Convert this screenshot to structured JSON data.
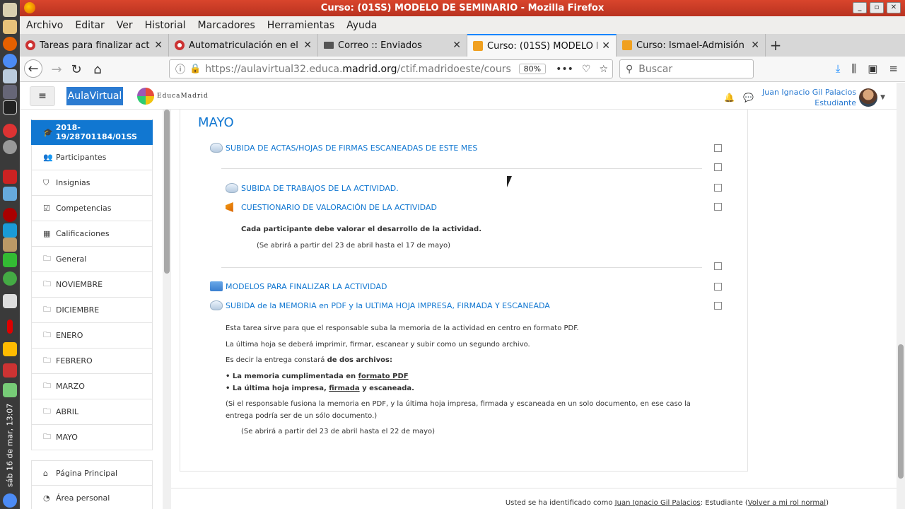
{
  "window": {
    "title": "Curso: (01SS) MODELO DE SEMINARIO - Mozilla Firefox"
  },
  "menu": [
    "Archivo",
    "Editar",
    "Ver",
    "Historial",
    "Marcadores",
    "Herramientas",
    "Ayuda"
  ],
  "tabs": [
    {
      "label": "Tareas para finalizar act",
      "active": false
    },
    {
      "label": "Automatriculación en el",
      "active": false
    },
    {
      "label": "Correo :: Enviados",
      "active": false
    },
    {
      "label": "Curso: (01SS) MODELO D",
      "active": true
    },
    {
      "label": "Curso: Ismael-Admisión",
      "active": false
    }
  ],
  "nav": {
    "url_prefix": "https://aulavirtual32.educa.",
    "url_domain": "madrid.org",
    "url_suffix": "/ctif.madridoeste/cours",
    "zoom": "80%",
    "search_placeholder": "Buscar"
  },
  "site": {
    "hamburger": "≡",
    "aula_button": "AulaVirtual",
    "logo_text": "EducaMadrid",
    "user_name": "Juan Ignacio Gil Palacios",
    "user_role": "Estudiante"
  },
  "sidebar": {
    "course": "2018-19/28701184/01SS",
    "items": [
      "Participantes",
      "Insignias",
      "Competencias",
      "Calificaciones",
      "General",
      "NOVIEMBRE",
      "DICIEMBRE",
      "ENERO",
      "FEBRERO",
      "MARZO",
      "ABRIL",
      "MAYO"
    ],
    "bottom": [
      "Página Principal",
      "Área personal"
    ]
  },
  "main": {
    "section_title": "MAYO",
    "activities": [
      "SUBIDA DE ACTAS/HOJAS DE FIRMAS ESCANEADAS DE ESTE MES",
      "SUBIDA DE TRABAJOS DE LA ACTIVIDAD.",
      "CUESTIONARIO DE VALORACIÓN DE LA ACTIVIDAD",
      "MODELOS PARA FINALIZAR LA ACTIVIDAD",
      "SUBIDA de la MEMORIA en PDF y la ULTIMA HOJA IMPRESA, FIRMADA Y ESCANEADA"
    ],
    "quest_desc": "Cada participante debe valorar el desarrollo de la actividad.",
    "quest_dates": "(Se abrirá a partir del 23 de abril hasta el 17 de mayo)",
    "memo_p1": "Esta tarea sirve para que el responsable suba la memoria de la actividad en centro en formato PDF.",
    "memo_p2": "La última hoja se deberá imprimir, firmar, escanear y subir como un segundo archivo.",
    "memo_p3_a": "Es decir la entrega constará ",
    "memo_p3_b": "de dos archivos:",
    "bullet1_a": "La memoria cumplimentada en ",
    "bullet1_b": "formato PDF",
    "bullet2_a": "La última hoja impresa, ",
    "bullet2_b": "firmada",
    "bullet2_c": " y escaneada.",
    "memo_p4_l1": "(Si el responsable fusiona la memoria en PDF, y la última hoja impresa, firmada y escaneada en un solo documento, en ese caso la",
    "memo_p4_l2": "entrega podría ser de un sólo documento.)",
    "memo_dates": "(Se abrirá a partir del 23 de abril hasta el 22 de mayo)"
  },
  "footer": {
    "prefix": "Usted se ha identificado como ",
    "user": "Juan Ignacio Gil Palacios",
    "role": ": Estudiante (",
    "link": "Volver a mi rol normal",
    "close": ")"
  },
  "taskbar": {
    "clock": "sáb 16 de mar, 13:07"
  }
}
